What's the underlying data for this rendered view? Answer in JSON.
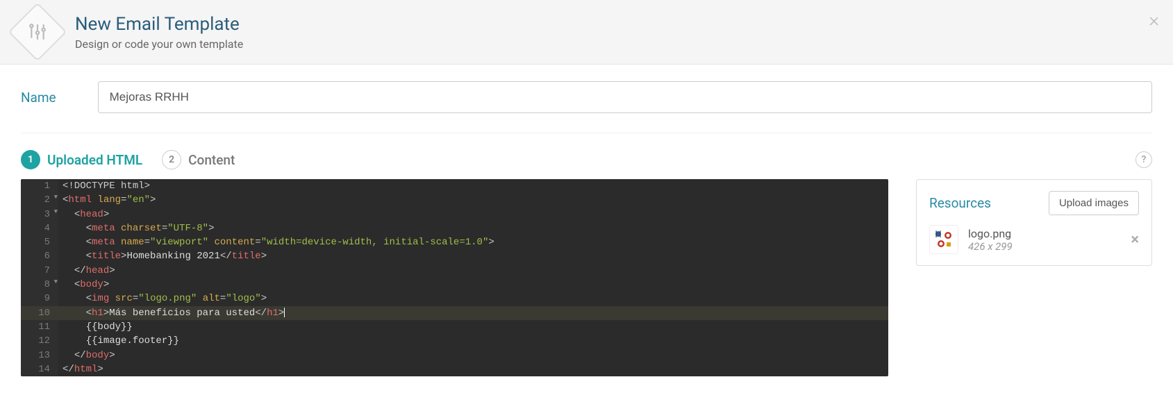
{
  "header": {
    "title": "New Email Template",
    "subtitle": "Design or code your own template"
  },
  "name": {
    "label": "Name",
    "value": "Mejoras RRHH"
  },
  "steps": {
    "s1": {
      "num": "1",
      "label": "Uploaded HTML"
    },
    "s2": {
      "num": "2",
      "label": "Content"
    }
  },
  "help": "?",
  "editor": {
    "lines": {
      "n1": "1",
      "n2": "2",
      "n3": "3",
      "n4": "4",
      "n5": "5",
      "n6": "6",
      "n7": "7",
      "n8": "8",
      "n9": "9",
      "n10": "10",
      "n11": "11",
      "n12": "12",
      "n13": "13",
      "n14": "14"
    },
    "l1": {
      "a": "<!DOCTYPE html>"
    },
    "l2": {
      "a": "<",
      "b": "html",
      "c": " ",
      "d": "lang",
      "e": "=",
      "f": "\"en\"",
      "g": ">"
    },
    "l3": {
      "a": "<",
      "b": "head",
      "c": ">"
    },
    "l4": {
      "a": "<",
      "b": "meta",
      "c": " ",
      "d": "charset",
      "e": "=",
      "f": "\"UTF-8\"",
      "g": ">"
    },
    "l5": {
      "a": "<",
      "b": "meta",
      "c": " ",
      "d": "name",
      "e": "=",
      "f": "\"viewport\"",
      "g": " ",
      "h": "content",
      "i": "=",
      "j": "\"width=device-width, initial-scale=1.0\"",
      "k": ">"
    },
    "l6": {
      "a": "<",
      "b": "title",
      "c": ">",
      "d": "Homebanking 2021",
      "e": "</",
      "f": "title",
      "g": ">"
    },
    "l7": {
      "a": "</",
      "b": "head",
      "c": ">"
    },
    "l8": {
      "a": "<",
      "b": "body",
      "c": ">"
    },
    "l9": {
      "a": "<",
      "b": "img",
      "c": " ",
      "d": "src",
      "e": "=",
      "f": "\"logo.png\"",
      "g": " ",
      "h": "alt",
      "i": "=",
      "j": "\"logo\"",
      "k": ">"
    },
    "l10": {
      "a": "<",
      "b": "h1",
      "c": ">",
      "d": "Más beneficios para usted",
      "e": "</",
      "f": "h1",
      "g": ">"
    },
    "l11": {
      "a": "{{body}}"
    },
    "l12": {
      "a": "{{image.footer}}"
    },
    "l13": {
      "a": "</",
      "b": "body",
      "c": ">"
    },
    "l14": {
      "a": "</",
      "b": "html",
      "c": ">"
    }
  },
  "resources": {
    "title": "Resources",
    "upload_label": "Upload images",
    "item": {
      "name": "logo.png",
      "dimensions": "426 x 299"
    }
  }
}
